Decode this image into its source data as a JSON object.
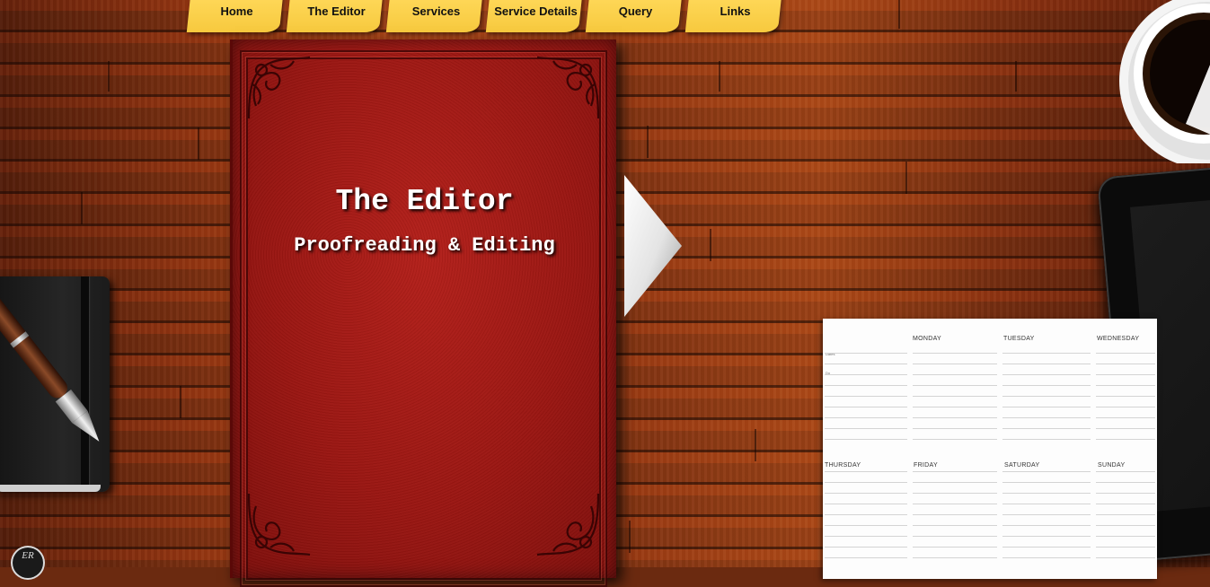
{
  "nav": {
    "tabs": [
      {
        "label": "Home"
      },
      {
        "label": "The Editor"
      },
      {
        "label": "Services"
      },
      {
        "label": "Service Details"
      },
      {
        "label": "Query"
      },
      {
        "label": "Links"
      }
    ]
  },
  "book": {
    "title": "The Editor",
    "subtitle": "Proofreading & Editing"
  },
  "planner": {
    "days_top": [
      "MONDAY",
      "TUESDAY",
      "WEDNESDAY"
    ],
    "days_bottom": [
      "THURSDAY",
      "FRIDAY",
      "SATURDAY",
      "SUNDAY"
    ],
    "side_labels": [
      "Dates",
      "Do"
    ]
  },
  "logo": {
    "text": "ER"
  },
  "colors": {
    "sticky_note": "#f7c93e",
    "book_red": "#9a1612",
    "wood": "#8a3612"
  },
  "icons": {
    "next_arrow": "next-arrow-icon",
    "coffee": "coffee-cup-icon",
    "pen": "pen-icon"
  }
}
